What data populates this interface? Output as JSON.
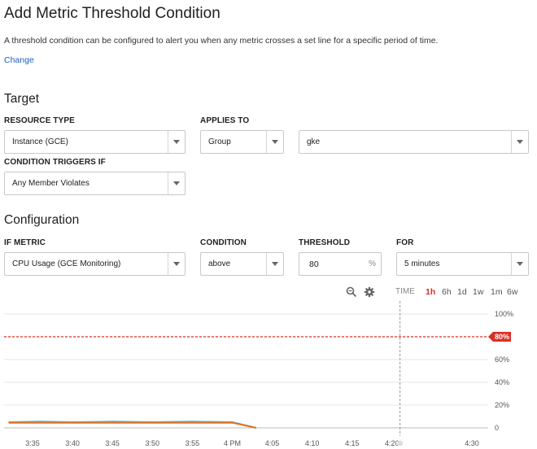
{
  "header": {
    "title": "Add Metric Threshold Condition",
    "description": "A threshold condition can be configured to alert you when any metric crosses a set line for a specific period of time.",
    "change_link": "Change"
  },
  "target": {
    "heading": "Target",
    "resource_type_label": "RESOURCE TYPE",
    "resource_type_value": "Instance (GCE)",
    "applies_to_label": "APPLIES TO",
    "applies_to_value": "Group",
    "group_value": "gke",
    "condition_triggers_label": "CONDITION TRIGGERS IF",
    "condition_triggers_value": "Any Member Violates"
  },
  "configuration": {
    "heading": "Configuration",
    "if_metric_label": "IF METRIC",
    "if_metric_value": "CPU Usage (GCE Monitoring)",
    "condition_label": "CONDITION",
    "condition_value": "above",
    "threshold_label": "THRESHOLD",
    "threshold_value": "80",
    "threshold_unit": "%",
    "for_label": "FOR",
    "for_value": "5 minutes"
  },
  "chart_toolbar": {
    "zoom_icon": "zoom-icon",
    "settings_icon": "gear-icon",
    "time_label": "TIME",
    "ranges": [
      "1h",
      "6h",
      "1d",
      "1w",
      "1m",
      "6w"
    ],
    "active_range": "1h"
  },
  "chart_data": {
    "type": "line",
    "x_ticks": [
      "3:35",
      "3:40",
      "3:45",
      "3:50",
      "3:55",
      "4 PM",
      "4:05",
      "4:10",
      "4:15",
      "4:20",
      "4:30"
    ],
    "y_ticks": [
      "0",
      "20%",
      "40%",
      "60%",
      "80%",
      "100%"
    ],
    "ylim": [
      0,
      100
    ],
    "threshold": {
      "value": 80,
      "label": "80%",
      "color": "#d93025"
    },
    "cursor_time": "4:21",
    "series": [
      {
        "color": "#4fb3d9",
        "x": [
          "3:32",
          "3:36",
          "3:40",
          "3:45",
          "3:50",
          "3:55",
          "4:00",
          "4:03"
        ],
        "values": [
          5,
          5.5,
          5,
          5.5,
          5,
          5.5,
          5,
          0
        ]
      },
      {
        "color": "#e8711c",
        "x": [
          "3:32",
          "3:36",
          "3:40",
          "3:45",
          "3:50",
          "3:55",
          "4:00",
          "4:03"
        ],
        "values": [
          4.5,
          4.5,
          4.5,
          4.5,
          4.5,
          4.5,
          4.5,
          0
        ]
      }
    ]
  }
}
